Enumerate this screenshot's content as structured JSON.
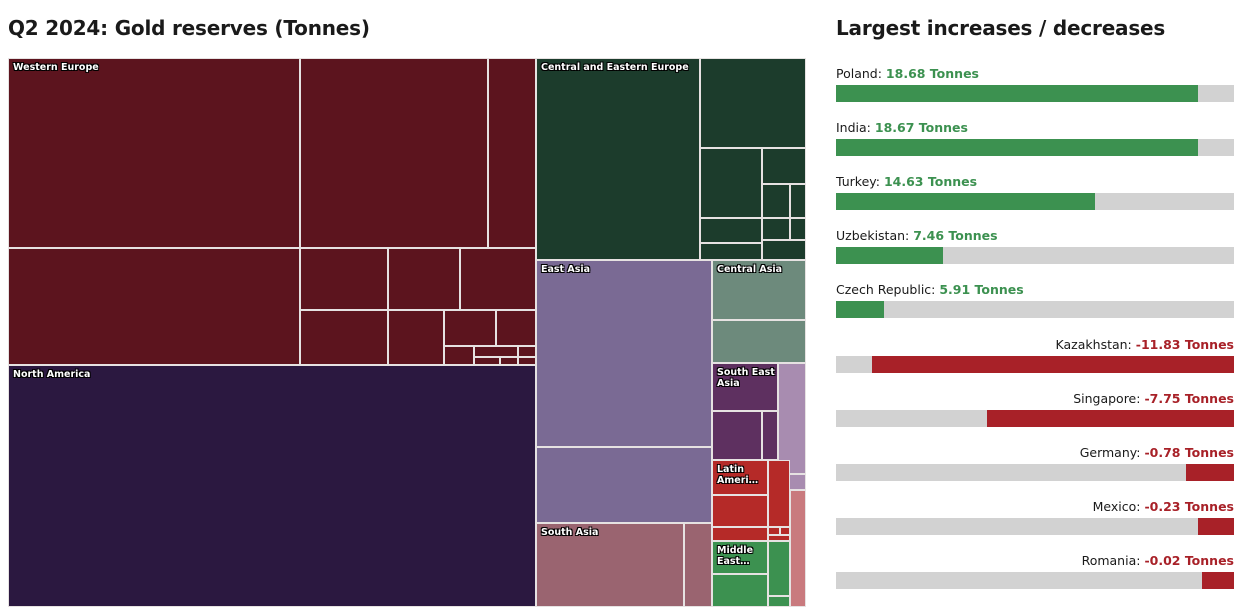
{
  "treemap": {
    "title": "Q2 2024: Gold reserves (Tonnes)",
    "regions": [
      {
        "label": "Western Europe",
        "color": "#5c141e"
      },
      {
        "label": "Central and Eastern Europe",
        "color": "#1c3c2c"
      },
      {
        "label": "North America",
        "color": "#2b1840"
      },
      {
        "label": "East Asia",
        "color": "#7a6a94"
      },
      {
        "label": "Central Asia",
        "color": "#6d8a7c"
      },
      {
        "label": "South East Asia",
        "color": "#5e3060"
      },
      {
        "label": "Latin Ameri…",
        "color": "#b52a28"
      },
      {
        "label": "South Asia",
        "color": "#9a6470"
      },
      {
        "label": "Middle East…",
        "color": "#3c9150"
      }
    ]
  },
  "changes": {
    "title": "Largest increases / decreases",
    "unit": "Tonnes",
    "positive_color": "#3c9150",
    "negative_color": "#a82128",
    "track_color": "#d2d2d2",
    "items": [
      {
        "name": "Poland",
        "value": "18.68",
        "label": "Poland: 18.68 Tonnes",
        "pct": 91,
        "sign": "pos"
      },
      {
        "name": "India",
        "value": "18.67",
        "label": "India: 18.67 Tonnes",
        "pct": 91,
        "sign": "pos"
      },
      {
        "name": "Turkey",
        "value": "14.63",
        "label": "Turkey: 14.63 Tonnes",
        "pct": 65,
        "sign": "pos"
      },
      {
        "name": "Uzbekistan",
        "value": "7.46",
        "label": "Uzbekistan: 7.46 Tonnes",
        "pct": 27,
        "sign": "pos"
      },
      {
        "name": "Czech Republic",
        "value": "5.91",
        "label": "Czech Republic: 5.91 Tonnes",
        "pct": 12,
        "sign": "pos"
      },
      {
        "name": "Kazakhstan",
        "value": "-11.83",
        "label": "Kazakhstan: -11.83 Tonnes",
        "pct": 91,
        "sign": "neg"
      },
      {
        "name": "Singapore",
        "value": "-7.75",
        "label": "Singapore: -7.75 Tonnes",
        "pct": 62,
        "sign": "neg"
      },
      {
        "name": "Germany",
        "value": "-0.78",
        "label": "Germany: -0.78 Tonnes",
        "pct": 12,
        "sign": "neg"
      },
      {
        "name": "Mexico",
        "value": "-0.23",
        "label": "Mexico: -0.23 Tonnes",
        "pct": 9,
        "sign": "neg"
      },
      {
        "name": "Romania",
        "value": "-0.02",
        "label": "Romania: -0.02 Tonnes",
        "pct": 8,
        "sign": "neg"
      }
    ]
  },
  "chart_data": [
    {
      "type": "treemap",
      "title": "Q2 2024: Gold reserves (Tonnes)",
      "value_unit": "Tonnes",
      "note": "Area-proportional treemap of gold reserves; outer groups are world regions, inner cells are individual countries (unlabelled at this size).",
      "groups": [
        {
          "name": "Western Europe",
          "color": "#5c141e",
          "area_share": 0.393,
          "cells": 17
        },
        {
          "name": "North America",
          "color": "#2b1840",
          "area_share": 0.285,
          "cells": 1
        },
        {
          "name": "Central and Eastern Europe",
          "color": "#1c3c2c",
          "area_share": 0.113,
          "cells": 11
        },
        {
          "name": "East Asia",
          "color": "#7a6a94",
          "area_share": 0.072,
          "cells": 4
        },
        {
          "name": "Central Asia",
          "color": "#6d8a7c",
          "area_share": 0.02,
          "cells": 2
        },
        {
          "name": "South East Asia",
          "color": "#5e3060",
          "area_share": 0.018,
          "cells": 3
        },
        {
          "name": "South Asia",
          "color": "#9a6470",
          "area_share": 0.017,
          "cells": 3
        },
        {
          "name": "Latin America",
          "color": "#b52a28",
          "area_share": 0.016,
          "cells": 7
        },
        {
          "name": "Middle East",
          "color": "#3c9150",
          "area_share": 0.012,
          "cells": 4
        }
      ]
    },
    {
      "type": "bar",
      "title": "Largest increases / decreases",
      "orientation": "horizontal",
      "xlabel": "Tonnes",
      "ylabel": "",
      "grid": false,
      "legend": "none",
      "categories": [
        "Poland",
        "India",
        "Turkey",
        "Uzbekistan",
        "Czech Republic",
        "Kazakhstan",
        "Singapore",
        "Germany",
        "Mexico",
        "Romania"
      ],
      "values": [
        18.68,
        18.67,
        14.63,
        7.46,
        5.91,
        -11.83,
        -7.75,
        -0.78,
        -0.23,
        -0.02
      ],
      "positive_color": "#3c9150",
      "negative_color": "#a82128"
    }
  ]
}
